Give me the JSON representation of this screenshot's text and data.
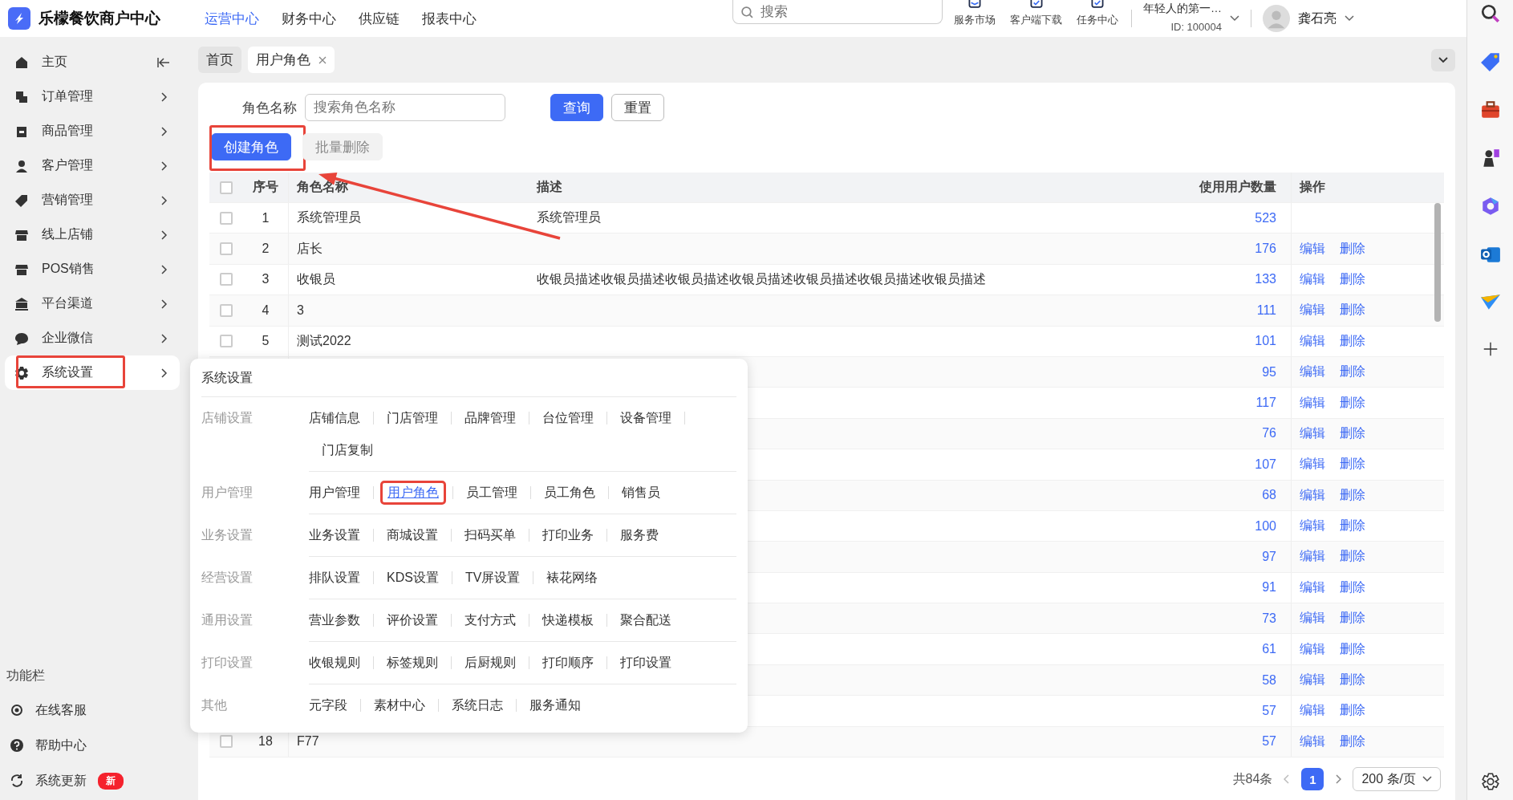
{
  "app": {
    "title": "乐檬餐饮商户中心"
  },
  "top_nav": [
    {
      "label": "运营中心",
      "selected": true
    },
    {
      "label": "财务中心",
      "selected": false
    },
    {
      "label": "供应链",
      "selected": false
    },
    {
      "label": "报表中心",
      "selected": false
    }
  ],
  "search": {
    "placeholder": "搜索"
  },
  "header_tools": [
    {
      "label": "服务市场"
    },
    {
      "label": "客户端下载"
    },
    {
      "label": "任务中心"
    }
  ],
  "store": {
    "name": "年轻人的第一…",
    "id": "ID: 100004"
  },
  "user": {
    "name": "龚石亮"
  },
  "sidebar": {
    "items": [
      {
        "label": "主页",
        "selected": false,
        "highlighted": false
      },
      {
        "label": "订单管理",
        "selected": false,
        "highlighted": false
      },
      {
        "label": "商品管理",
        "selected": false,
        "highlighted": false
      },
      {
        "label": "客户管理",
        "selected": false,
        "highlighted": false
      },
      {
        "label": "营销管理",
        "selected": false,
        "highlighted": false
      },
      {
        "label": "线上店铺",
        "selected": false,
        "highlighted": false
      },
      {
        "label": "POS销售",
        "selected": false,
        "highlighted": false
      },
      {
        "label": "平台渠道",
        "selected": false,
        "highlighted": false
      },
      {
        "label": "企业微信",
        "selected": false,
        "highlighted": false
      },
      {
        "label": "系统设置",
        "selected": true,
        "highlighted": true
      }
    ],
    "section_title": "功能栏",
    "footer_items": [
      {
        "label": "在线客服"
      },
      {
        "label": "帮助中心"
      },
      {
        "label": "系统更新",
        "badge": "新"
      }
    ]
  },
  "page_tabs": [
    {
      "label": "首页",
      "selected": false,
      "closable": false
    },
    {
      "label": "用户角色",
      "selected": true,
      "closable": true
    }
  ],
  "filter": {
    "label": "角色名称",
    "placeholder": "搜索角色名称",
    "buttons": [
      {
        "label": "查询",
        "kind": "primary"
      },
      {
        "label": "重置",
        "kind": "default"
      }
    ]
  },
  "actions": [
    {
      "label": "创建角色",
      "kind": "primary",
      "disabled": false,
      "highlighted": true
    },
    {
      "label": "批量删除",
      "kind": "default",
      "disabled": true,
      "highlighted": false
    }
  ],
  "table": {
    "select_all_checked": false,
    "columns": [
      "序号",
      "角色名称",
      "描述",
      "使用用户数量",
      "操作"
    ],
    "rows": [
      {
        "no": "1",
        "name": "系统管理员",
        "description": "系统管理员",
        "user_count": "523",
        "checked": false,
        "actions": []
      },
      {
        "no": "2",
        "name": "店长",
        "user_count": "176",
        "checked": false,
        "actions": [
          "编辑",
          "删除"
        ]
      },
      {
        "no": "3",
        "name": "收银员",
        "description": "收银员描述收银员描述收银员描述收银员描述收银员描述收银员描述收银员描述",
        "user_count": "133",
        "checked": false,
        "actions": [
          "编辑",
          "删除"
        ]
      },
      {
        "no": "4",
        "name": "3",
        "user_count": "111",
        "checked": false,
        "actions": [
          "编辑",
          "删除"
        ]
      },
      {
        "no": "5",
        "name": "测试2022",
        "user_count": "101",
        "checked": false,
        "actions": [
          "编辑",
          "删除"
        ]
      },
      {
        "user_count": "95",
        "actions": [
          "编辑",
          "删除"
        ]
      },
      {
        "user_count": "117",
        "actions": [
          "编辑",
          "删除"
        ]
      },
      {
        "user_count": "76",
        "actions": [
          "编辑",
          "删除"
        ]
      },
      {
        "user_count": "107",
        "actions": [
          "编辑",
          "删除"
        ]
      },
      {
        "user_count": "68",
        "actions": [
          "编辑",
          "删除"
        ]
      },
      {
        "user_count": "100",
        "actions": [
          "编辑",
          "删除"
        ]
      },
      {
        "user_count": "97",
        "actions": [
          "编辑",
          "删除"
        ]
      },
      {
        "user_count": "91",
        "actions": [
          "编辑",
          "删除"
        ]
      },
      {
        "user_count": "73",
        "actions": [
          "编辑",
          "删除"
        ]
      },
      {
        "user_count": "61",
        "actions": [
          "编辑",
          "删除"
        ]
      },
      {
        "user_count": "58",
        "actions": [
          "编辑",
          "删除"
        ]
      },
      {
        "user_count": "57",
        "actions": [
          "编辑",
          "删除"
        ]
      },
      {
        "no": "18",
        "name": "F77",
        "user_count": "57",
        "checked": false,
        "actions": [
          "编辑",
          "删除"
        ]
      }
    ]
  },
  "pagination": {
    "total": "共84条",
    "pages": [
      {
        "label": "1",
        "selected": true
      }
    ],
    "page_size": "200 条/页"
  },
  "menu_popup": {
    "title": "系统设置",
    "groups": [
      {
        "label": "店铺设置",
        "links": [
          {
            "label": "店铺信息",
            "selected": false,
            "highlighted": false
          },
          {
            "label": "门店管理",
            "selected": false,
            "highlighted": false
          },
          {
            "label": "品牌管理",
            "selected": false,
            "highlighted": false
          },
          {
            "label": "台位管理",
            "selected": false,
            "highlighted": false
          },
          {
            "label": "设备管理",
            "selected": false,
            "highlighted": false
          },
          {
            "label": "门店复制",
            "selected": false,
            "highlighted": false
          }
        ]
      },
      {
        "label": "用户管理",
        "links": [
          {
            "label": "用户管理",
            "selected": false,
            "highlighted": false
          },
          {
            "label": "用户角色",
            "selected": true,
            "highlighted": true
          },
          {
            "label": "员工管理",
            "selected": false,
            "highlighted": false
          },
          {
            "label": "员工角色",
            "selected": false,
            "highlighted": false
          },
          {
            "label": "销售员",
            "selected": false,
            "highlighted": false
          }
        ]
      },
      {
        "label": "业务设置",
        "links": [
          {
            "label": "业务设置",
            "selected": false,
            "highlighted": false
          },
          {
            "label": "商城设置",
            "selected": false,
            "highlighted": false
          },
          {
            "label": "扫码买单",
            "selected": false,
            "highlighted": false
          },
          {
            "label": "打印业务",
            "selected": false,
            "highlighted": false
          },
          {
            "label": "服务费",
            "selected": false,
            "highlighted": false
          }
        ]
      },
      {
        "label": "经营设置",
        "links": [
          {
            "label": "排队设置",
            "selected": false,
            "highlighted": false
          },
          {
            "label": "KDS设置",
            "selected": false,
            "highlighted": false
          },
          {
            "label": "TV屏设置",
            "selected": false,
            "highlighted": false
          },
          {
            "label": "裱花网络",
            "selected": false,
            "highlighted": false
          }
        ]
      },
      {
        "label": "通用设置",
        "links": [
          {
            "label": "营业参数",
            "selected": false,
            "highlighted": false
          },
          {
            "label": "评价设置",
            "selected": false,
            "highlighted": false
          },
          {
            "label": "支付方式",
            "selected": false,
            "highlighted": false
          },
          {
            "label": "快递模板",
            "selected": false,
            "highlighted": false
          },
          {
            "label": "聚合配送",
            "selected": false,
            "highlighted": false
          }
        ]
      },
      {
        "label": "打印设置",
        "links": [
          {
            "label": "收银规则",
            "selected": false,
            "highlighted": false
          },
          {
            "label": "标签规则",
            "selected": false,
            "highlighted": false
          },
          {
            "label": "后厨规则",
            "selected": false,
            "highlighted": false
          },
          {
            "label": "打印顺序",
            "selected": false,
            "highlighted": false
          },
          {
            "label": "打印设置",
            "selected": false,
            "highlighted": false
          }
        ]
      },
      {
        "label": "其他",
        "links": [
          {
            "label": "元字段",
            "selected": false,
            "highlighted": false
          },
          {
            "label": "素材中心",
            "selected": false,
            "highlighted": false
          },
          {
            "label": "系统日志",
            "selected": false,
            "highlighted": false
          },
          {
            "label": "服务通知",
            "selected": false,
            "highlighted": false
          }
        ]
      }
    ]
  },
  "annotation_arrow": true
}
